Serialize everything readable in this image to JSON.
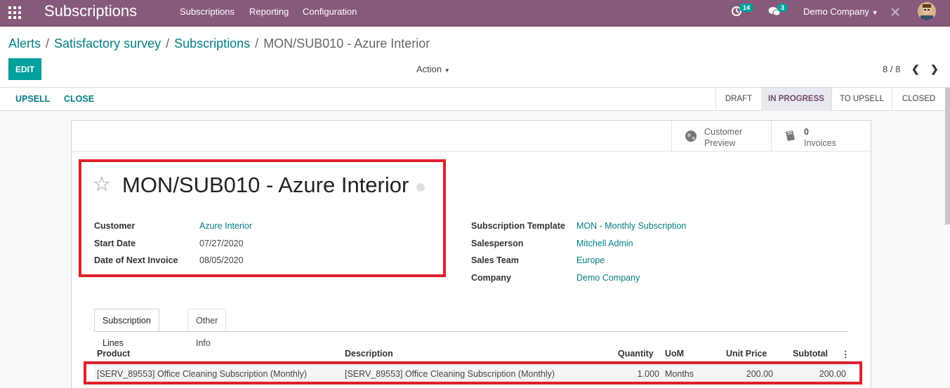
{
  "topbar": {
    "brand": "Subscriptions",
    "menu": [
      "Subscriptions",
      "Reporting",
      "Configuration"
    ],
    "activity_count": "14",
    "message_count": "3",
    "company": "Demo Company",
    "bar_color": "#875a7b"
  },
  "breadcrumb": {
    "items": [
      "Alerts",
      "Satisfactory survey",
      "Subscriptions"
    ],
    "current": "MON/SUB010 - Azure Interior"
  },
  "controls": {
    "edit_label": "EDIT",
    "action_label": "Action",
    "pager": "8 / 8"
  },
  "statusbar": {
    "buttons": [
      "UPSELL",
      "CLOSE"
    ],
    "stages": [
      "DRAFT",
      "IN PROGRESS",
      "TO UPSELL",
      "CLOSED"
    ],
    "active_stage": "IN PROGRESS"
  },
  "smart_buttons": {
    "preview_label1": "Customer",
    "preview_label2": "Preview",
    "invoices_count": "0",
    "invoices_label": "Invoices"
  },
  "record": {
    "title": "MON/SUB010 - Azure Interior",
    "left_fields": [
      {
        "label": "Customer",
        "value": "Azure Interior"
      },
      {
        "label": "Start Date",
        "value": "07/27/2020"
      },
      {
        "label": "Date of Next Invoice",
        "value": "08/05/2020"
      }
    ],
    "right_fields": [
      {
        "label": "Subscription Template",
        "value": "MON - Monthly Subscription"
      },
      {
        "label": "Salesperson",
        "value": "Mitchell Admin"
      },
      {
        "label": "Sales Team",
        "value": "Europe"
      },
      {
        "label": "Company",
        "value": "Demo Company"
      }
    ]
  },
  "tabs": [
    "Subscription Lines",
    "Other Info"
  ],
  "lines": {
    "columns": [
      "Product",
      "Description",
      "Quantity",
      "UoM",
      "Unit Price",
      "Subtotal"
    ],
    "rows": [
      {
        "product": "[SERV_89553] Office Cleaning Subscription (Monthly)",
        "description": "[SERV_89553] Office Cleaning Subscription (Monthly)",
        "quantity": "1.000",
        "uom": "Months",
        "unit_price": "200.00",
        "subtotal": "200.00"
      }
    ]
  },
  "colors": {
    "accent": "#00a09d",
    "link": "#017e84",
    "highlight": "#e0202a"
  }
}
